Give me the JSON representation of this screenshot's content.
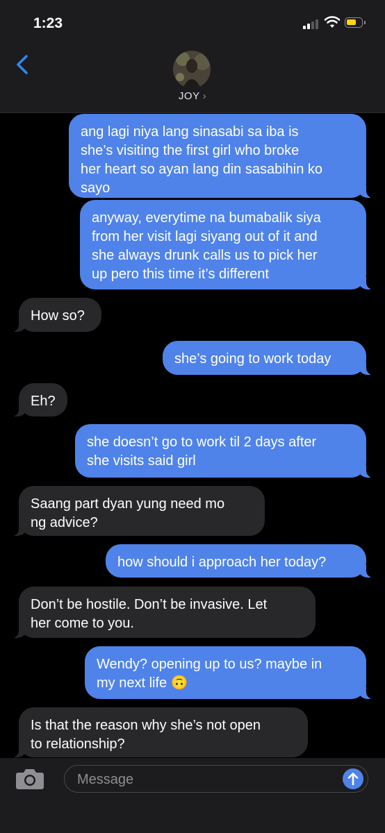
{
  "status_bar": {
    "time": "1:23",
    "battery_color": "#ffd60a"
  },
  "header": {
    "contact_name": "JOY",
    "chevron": "›",
    "back_icon": "chevron-left-icon"
  },
  "messages": [
    {
      "direction": "outgoing",
      "text": "ang lagi niya lang sinasabi sa iba is\nshe’s visiting the first girl who broke\nher heart so ayan lang din sasabihin ko\nsayo"
    },
    {
      "direction": "outgoing",
      "text": "anyway, everytime na bumabalik siya\nfrom her visit lagi siyang out of it and\nshe always drunk calls us to pick her\nup pero this time it’s different"
    },
    {
      "direction": "incoming",
      "text": "How so?"
    },
    {
      "direction": "outgoing",
      "text": "she’s going to work today"
    },
    {
      "direction": "incoming",
      "text": "Eh?"
    },
    {
      "direction": "outgoing",
      "text": "she doesn’t go to work til 2 days after\nshe visits said girl"
    },
    {
      "direction": "incoming",
      "text": "Saang part dyan yung need mo\nng advice?"
    },
    {
      "direction": "outgoing",
      "text": "how should i approach her today?"
    },
    {
      "direction": "incoming",
      "text": "Don’t be hostile. Don’t be invasive. Let\nher come to you."
    },
    {
      "direction": "outgoing",
      "text": "Wendy? opening up to us? maybe in\nmy next life 🙃"
    },
    {
      "direction": "incoming",
      "text": "Is that the reason why she’s not open\nto relationship?"
    }
  ],
  "input": {
    "placeholder": "Message",
    "value": ""
  },
  "colors": {
    "outgoing_bubble": "#4f83ea",
    "incoming_bubble": "#28282b",
    "accent": "#2f86f6"
  }
}
